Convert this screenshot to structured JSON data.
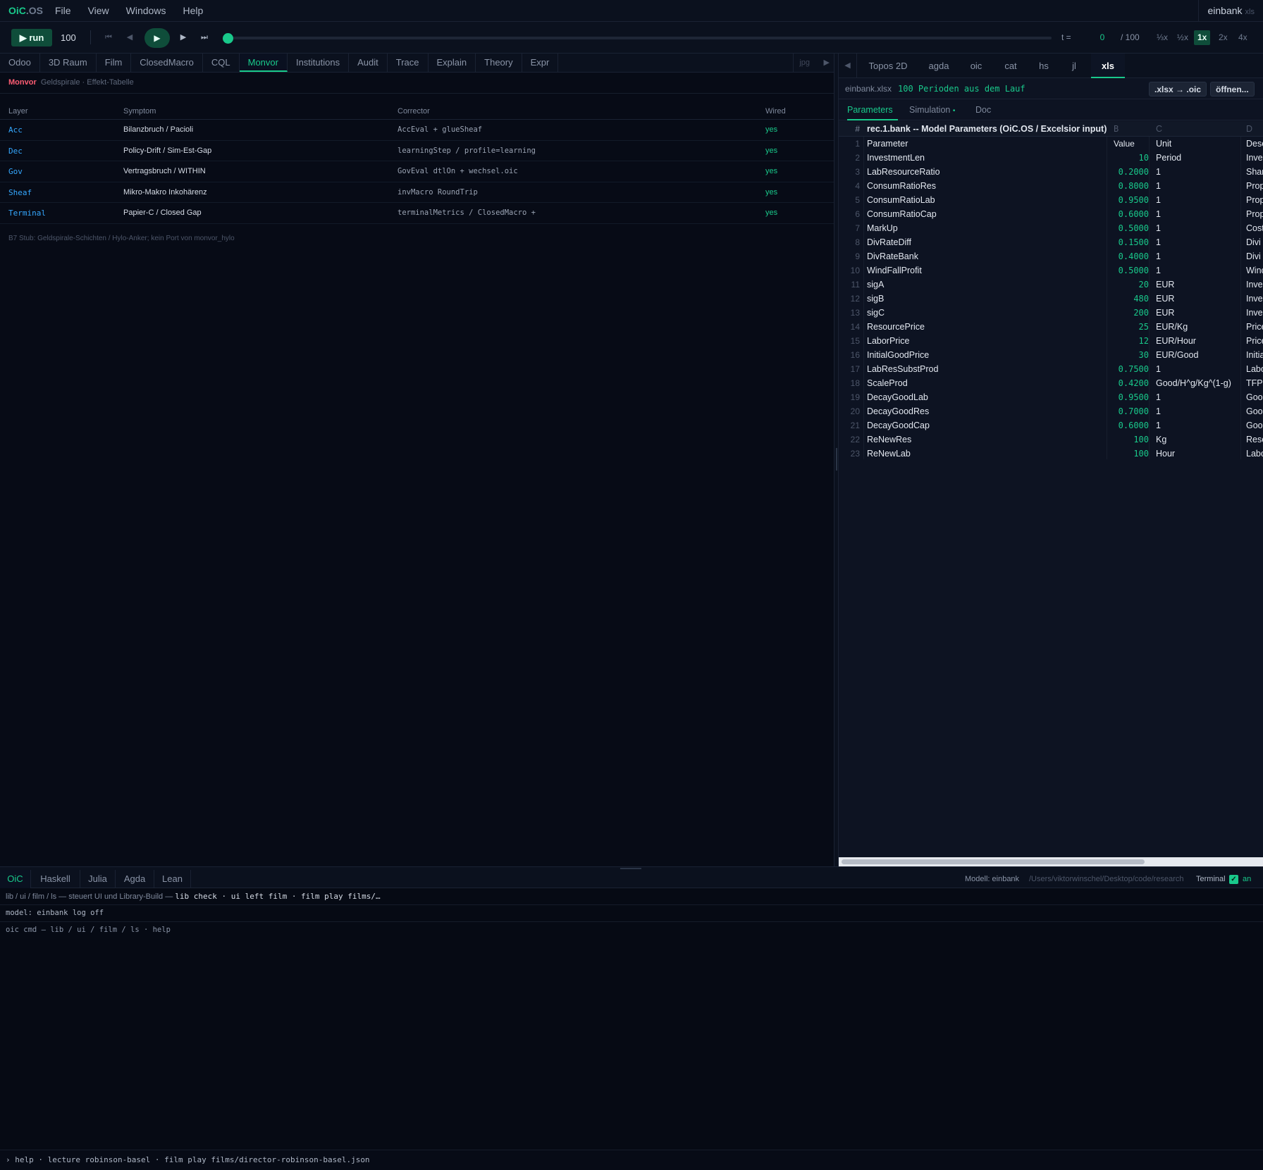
{
  "app": {
    "brand_main": "OiC",
    "brand_suffix": ".OS",
    "model": "einbank",
    "model_tag": "xls"
  },
  "menu": [
    "File",
    "View",
    "Windows",
    "Help"
  ],
  "playbar": {
    "run_label": "▶ run",
    "run_count": "100",
    "t_label": "t =",
    "t_value": "0",
    "t_max": "/ 100",
    "progress": 0,
    "speeds": [
      "⅓x",
      "½x",
      "1x",
      "2x",
      "4x"
    ],
    "active_speed": "1x"
  },
  "left_tabs": [
    "Odoo",
    "3D Raum",
    "Film",
    "ClosedMacro",
    "CQL",
    "Monvor",
    "Institutions",
    "Audit",
    "Trace",
    "Explain",
    "Theory",
    "Expr"
  ],
  "left_active_tab": "Monvor",
  "left_tab_extra": "jpg",
  "monvor": {
    "title": "Monvor",
    "subtitle": "Geldspirale · Effekt-Tabelle",
    "headers": {
      "layer": "Layer",
      "symptom": "Symptom",
      "corrector": "Corrector",
      "wired": "Wired"
    },
    "rows": [
      {
        "layer": "Acc",
        "symptom": "Bilanzbruch / Pacioli",
        "corrector": "AccEval + glueSheaf",
        "wired": "yes"
      },
      {
        "layer": "Dec",
        "symptom": "Policy-Drift / Sim-Est-Gap",
        "corrector": "learningStep / profile=learning",
        "wired": "yes"
      },
      {
        "layer": "Gov",
        "symptom": "Vertragsbruch / WITHIN",
        "corrector": "GovEval dtlOn + wechsel.oic",
        "wired": "yes"
      },
      {
        "layer": "Sheaf",
        "symptom": "Mikro-Makro Inkohärenz",
        "corrector": "invMacro RoundTrip",
        "wired": "yes"
      },
      {
        "layer": "Terminal",
        "symptom": "Papier-C / Closed Gap",
        "corrector": "terminalMetrics / ClosedMacro +",
        "wired": "yes"
      }
    ],
    "footnote": "B7 Stub: Geldspirale-Schichten / Hylo-Anker; kein Port von monvor_hylo"
  },
  "right_tabs": [
    "Topos 2D",
    "agda",
    "oic",
    "cat",
    "hs",
    "jl",
    "xls"
  ],
  "right_active_tab": "xls",
  "file": {
    "name": "einbank.xlsx",
    "desc": "100 Perioden aus dem Lauf",
    "convert_label": ".xlsx → .oic",
    "open_label": "öffnen..."
  },
  "sub_tabs": {
    "parameters": "Parameters",
    "simulation": "Simulation",
    "simulation_dot": "•",
    "doc": "Doc"
  },
  "sheet": {
    "col_hash": "#",
    "title": "rec.1.bank -- Model Parameters (OiC.OS / Excelsior input)",
    "col_b": "B",
    "col_c": "C",
    "col_d": "D",
    "rows": [
      {
        "n": "1",
        "a": "Parameter",
        "b": "Value",
        "c": "Unit",
        "d": "Desc"
      },
      {
        "n": "2",
        "a": "InvestmentLen",
        "b": "10",
        "c": "Period",
        "d": "Inve"
      },
      {
        "n": "3",
        "a": "LabResourceRatio",
        "b": "0.2000",
        "c": "1",
        "d": "Shar"
      },
      {
        "n": "4",
        "a": "ConsumRatioRes",
        "b": "0.8000",
        "c": "1",
        "d": "Prop"
      },
      {
        "n": "5",
        "a": "ConsumRatioLab",
        "b": "0.9500",
        "c": "1",
        "d": "Prop"
      },
      {
        "n": "6",
        "a": "ConsumRatioCap",
        "b": "0.6000",
        "c": "1",
        "d": "Prop"
      },
      {
        "n": "7",
        "a": "MarkUp",
        "b": "0.5000",
        "c": "1",
        "d": "Cost"
      },
      {
        "n": "8",
        "a": "DivRateDiff",
        "b": "0.1500",
        "c": "1",
        "d": "Divi"
      },
      {
        "n": "9",
        "a": "DivRateBank",
        "b": "0.4000",
        "c": "1",
        "d": "Divi"
      },
      {
        "n": "10",
        "a": "WindFallProfit",
        "b": "0.5000",
        "c": "1",
        "d": "Winc"
      },
      {
        "n": "11",
        "a": "sigA",
        "b": "20",
        "c": "EUR",
        "d": "Inve"
      },
      {
        "n": "12",
        "a": "sigB",
        "b": "480",
        "c": "EUR",
        "d": "Inve"
      },
      {
        "n": "13",
        "a": "sigC",
        "b": "200",
        "c": "EUR",
        "d": "Inve"
      },
      {
        "n": "14",
        "a": "ResourcePrice",
        "b": "25",
        "c": "EUR/Kg",
        "d": "Price"
      },
      {
        "n": "15",
        "a": "LaborPrice",
        "b": "12",
        "c": "EUR/Hour",
        "d": "Price"
      },
      {
        "n": "16",
        "a": "InitialGoodPrice",
        "b": "30",
        "c": "EUR/Good",
        "d": "Initia"
      },
      {
        "n": "17",
        "a": "LabResSubstProd",
        "b": "0.7500",
        "c": "1",
        "d": "Labo"
      },
      {
        "n": "18",
        "a": "ScaleProd",
        "b": "0.4200",
        "c": "Good/H^g/Kg^(1-g)",
        "d": "TFP"
      },
      {
        "n": "19",
        "a": "DecayGoodLab",
        "b": "0.9500",
        "c": "1",
        "d": "Goo"
      },
      {
        "n": "20",
        "a": "DecayGoodRes",
        "b": "0.7000",
        "c": "1",
        "d": "Goo"
      },
      {
        "n": "21",
        "a": "DecayGoodCap",
        "b": "0.6000",
        "c": "1",
        "d": "Goo"
      },
      {
        "n": "22",
        "a": "ReNewRes",
        "b": "100",
        "c": "Kg",
        "d": "Reso"
      },
      {
        "n": "23",
        "a": "ReNewLab",
        "b": "100",
        "c": "Hour",
        "d": "Labo"
      }
    ]
  },
  "bottom_tabs": [
    "OiC",
    "Haskell",
    "Julia",
    "Agda",
    "Lean"
  ],
  "bottom_active_tab": "OiC",
  "bottom_status": {
    "model": "Modell: einbank",
    "path": "/Users/viktorwinschel/Desktop/code/research",
    "terminal": "Terminal",
    "toggle": "an"
  },
  "console": {
    "hint_prefix": "lib / ui / film / ls — steuert UI und Library-Build —",
    "hint_cmds": "lib check · ui left film · film play films/…",
    "model_line": "model: einbank  log off",
    "cmd_line": "oic cmd — lib / ui / film / ls · help",
    "footer": "› help · lecture robinson-basel · film play films/director-robinson-basel.json"
  }
}
